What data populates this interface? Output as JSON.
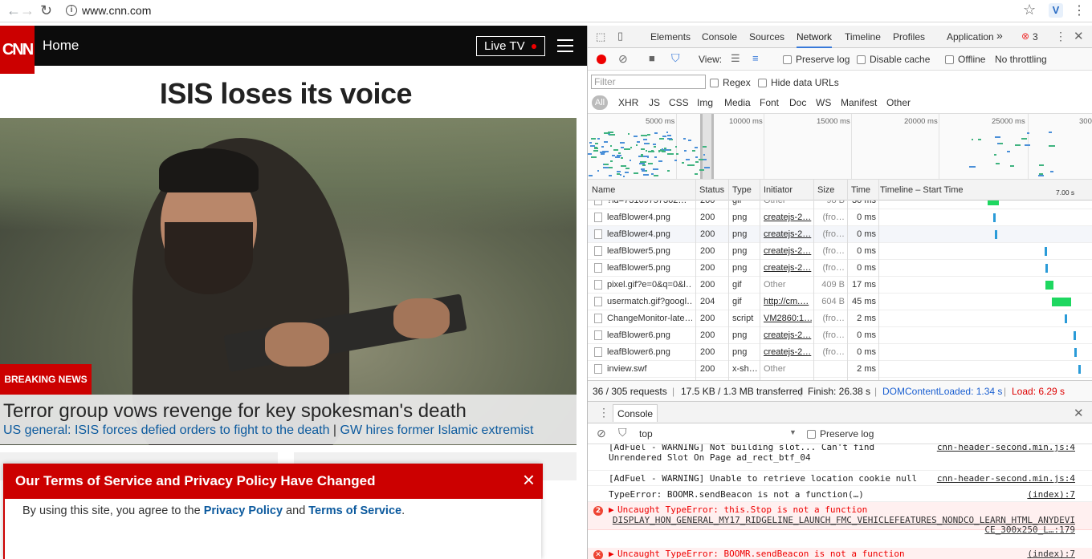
{
  "browser": {
    "url": "www.cnn.com"
  },
  "cnn": {
    "logo": "CNN",
    "nav_home": "Home",
    "live_tv": "Live TV",
    "headline": "ISIS loses its voice",
    "breaking_label": "BREAKING NEWS",
    "story_title": "Terror group vows revenge for key spokesman's death",
    "sublink1": "US general: ISIS forces defied orders to fight to the death",
    "sublink_sep": "|",
    "sublink2": "GW hires former Islamic extremist",
    "tos": {
      "title": "Our Terms of Service and Privacy Policy Have Changed",
      "close": "×",
      "text_prefix": "By using this site, you agree to the ",
      "privacy_link": "Privacy Policy",
      "and": " and ",
      "terms_link": "Terms of Service",
      "period": "."
    }
  },
  "devtools": {
    "tabs": [
      "Elements",
      "Console",
      "Sources",
      "Network",
      "Timeline",
      "Profiles",
      "Application"
    ],
    "active_tab": "Network",
    "more": "»",
    "error_count": "3",
    "toolbar": {
      "view_label": "View:",
      "preserve_log": "Preserve log",
      "disable_cache": "Disable cache",
      "offline": "Offline",
      "throttling": "No throttling"
    },
    "filter_placeholder": "Filter",
    "regex": "Regex",
    "hide_data_urls": "Hide data URLs",
    "types": [
      "All",
      "XHR",
      "JS",
      "CSS",
      "Img",
      "Media",
      "Font",
      "Doc",
      "WS",
      "Manifest",
      "Other"
    ],
    "overview_ticks": [
      "5000 ms",
      "10000 ms",
      "15000 ms",
      "20000 ms",
      "25000 ms",
      "300"
    ],
    "columns": [
      "Name",
      "Status",
      "Type",
      "Initiator",
      "Size",
      "Time",
      "Timeline – Start Time"
    ],
    "timeline_tick": "7.00 s",
    "requests": [
      {
        "name": "?id=73169757362…",
        "status": "200",
        "type": "gif",
        "initiator": "Other",
        "size": "98 B",
        "time": "30 ms"
      },
      {
        "name": "leafBlower4.png",
        "status": "200",
        "type": "png",
        "initiator": "createjs-2…",
        "size": "(fro…",
        "time": "0 ms"
      },
      {
        "name": "leafBlower4.png",
        "status": "200",
        "type": "png",
        "initiator": "createjs-2…",
        "size": "(fro…",
        "time": "0 ms"
      },
      {
        "name": "leafBlower5.png",
        "status": "200",
        "type": "png",
        "initiator": "createjs-2…",
        "size": "(fro…",
        "time": "0 ms"
      },
      {
        "name": "leafBlower5.png",
        "status": "200",
        "type": "png",
        "initiator": "createjs-2…",
        "size": "(fro…",
        "time": "0 ms"
      },
      {
        "name": "pixel.gif?e=0&q=0&l…",
        "status": "200",
        "type": "gif",
        "initiator": "Other",
        "size": "409 B",
        "time": "17 ms"
      },
      {
        "name": "usermatch.gif?googl…",
        "status": "204",
        "type": "gif",
        "initiator": "http://cm.…",
        "size": "604 B",
        "time": "45 ms"
      },
      {
        "name": "ChangeMonitor-late…",
        "status": "200",
        "type": "script",
        "initiator": "VM2860:1…",
        "size": "(fro…",
        "time": "2 ms"
      },
      {
        "name": "leafBlower6.png",
        "status": "200",
        "type": "png",
        "initiator": "createjs-2…",
        "size": "(fro…",
        "time": "0 ms"
      },
      {
        "name": "leafBlower6.png",
        "status": "200",
        "type": "png",
        "initiator": "createjs-2…",
        "size": "(fro…",
        "time": "0 ms"
      },
      {
        "name": "inview.swf",
        "status": "200",
        "type": "x-sh…",
        "initiator": "Other",
        "size": "",
        "time": "2 ms"
      }
    ],
    "summary": {
      "requests": "36 / 305 requests",
      "transferred": "17.5 KB / 1.3 MB transferred",
      "finish": "Finish: 26.38 s",
      "dcl": "DOMContentLoaded: 1.34 s",
      "load": "Load: 6.29 s",
      "sep": "|"
    },
    "console": {
      "tab": "Console",
      "context": "top",
      "preserve_log": "Preserve log",
      "lines": [
        {
          "msg": "[AdFuel - WARNING] Not building slot... Can't find",
          "src": "cnn-header-second.min.js:4"
        },
        {
          "msg": "Unrendered Slot On Page ad_rect_btf_04",
          "src": ""
        },
        {
          "msg": "[AdFuel - WARNING] Unable to retrieve location cookie null",
          "src": "cnn-header-second.min.js:4"
        },
        {
          "msg": "TypeError: BOOMR.sendBeacon is not a function(…)",
          "src": "(index):7"
        }
      ],
      "error1_count": "2",
      "error1_msg": "Uncaught TypeError: this.Stop is not a function",
      "error1_src1": "DISPLAY_HON_GENERAL_MY17_RIDGELINE_LAUNCH_FMC_VEHICLEFEATURES_NONDCO_LEARN_HTML_ANYDEVI",
      "error1_src2": "CE_300x250_L…:179",
      "error2_msg": "Uncaught TypeError: BOOMR.sendBeacon is not a function",
      "error2_src": "(index):7",
      "prompt": "›"
    }
  }
}
